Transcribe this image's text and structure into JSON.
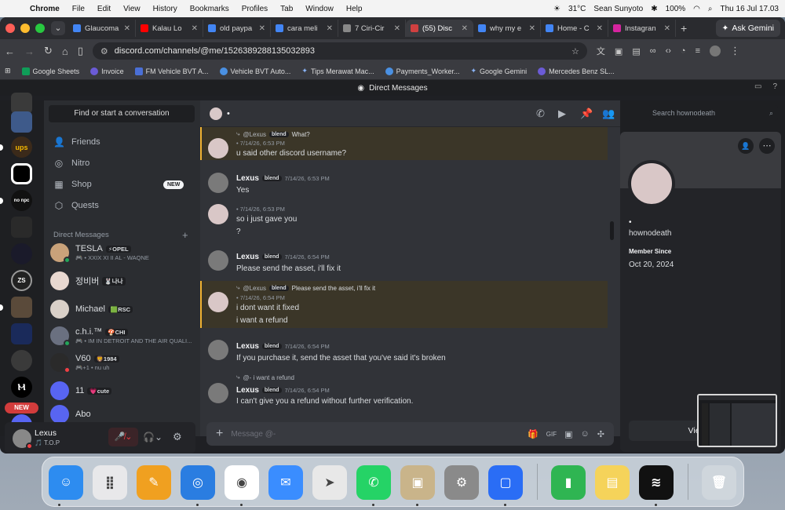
{
  "menubar": {
    "app": "Chrome",
    "items": [
      "File",
      "Edit",
      "View",
      "History",
      "Bookmarks",
      "Profiles",
      "Tab",
      "Window",
      "Help"
    ],
    "temp": "31°C",
    "user": "Sean Sunyoto",
    "battery": "100%",
    "datetime": "Thu 16 Jul  17.03"
  },
  "tabs": [
    {
      "title": "Glaucoma",
      "color": "#4285f4"
    },
    {
      "title": "Kalau Lo ",
      "color": "#ff0000"
    },
    {
      "title": "old paypa",
      "color": "#4285f4"
    },
    {
      "title": "cara meli",
      "color": "#4285f4"
    },
    {
      "title": "7 Ciri-Cir",
      "color": "#888888"
    },
    {
      "title": "(55) Disc",
      "color": "#d04040",
      "active": true
    },
    {
      "title": "why my e",
      "color": "#4285f4"
    },
    {
      "title": "Home - C",
      "color": "#4285f4"
    },
    {
      "title": "Instagran",
      "color": "#d6249f"
    }
  ],
  "gemini_label": "Ask Gemini",
  "url": "discord.com/channels/@me/1526389288135032893",
  "bookmarks": [
    "Google Sheets",
    "Invoice",
    "FM Vehicle BVT A...",
    "Vehicle BVT Auto...",
    "Tips Merawat Mac...",
    "Payments_Worker...",
    "Google Gemini",
    "Mercedes Benz SL..."
  ],
  "discord_title": "Direct Messages",
  "find": "Find or start a conversation",
  "nav": [
    "Friends",
    "Nitro",
    "Shop",
    "Quests"
  ],
  "new_tag": "NEW",
  "dm_header": "Direct Messages",
  "dms": [
    {
      "name": "TESLA",
      "tag": "⚡OPEL",
      "sub": "🎮 • XXIX XI II AL - WAQNE",
      "color": "#c9a27a"
    },
    {
      "name": "정비버",
      "tag": "🐰나나",
      "sub": "",
      "color": "#e8d8d0"
    },
    {
      "name": "Michael",
      "tag": "🟩RSC",
      "sub": "",
      "color": "#d9d0c8"
    },
    {
      "name": "c.h.i.™",
      "tag": "🍄CHI",
      "sub": "🎮 • IM IN DETROIT AND THE AIR QUALI...",
      "color": "#6a7080"
    },
    {
      "name": "V60",
      "tag": "🦁1984",
      "sub": "🎮+1 • nu uh",
      "color": "#2a2a2a"
    },
    {
      "name": "11",
      "tag": "💗cute",
      "sub": "",
      "color": "#5865f2"
    },
    {
      "name": "Abo",
      "tag": "",
      "sub": "",
      "color": "#5865f2"
    }
  ],
  "user": {
    "name": "Lexus",
    "status": "🎵 T.O.P"
  },
  "new_badge": "NEW",
  "header_name": "•",
  "search_placeholder": "Search hownodeath",
  "messages": {
    "m1_reply_name": "@Lexus",
    "m1_reply_tag": "blend",
    "m1_reply_text": "What?",
    "m1_time": "• 7/14/26, 6:53 PM",
    "m1_text": "u said other discord username?",
    "m2_name": "Lexus",
    "m2_tag": "blend",
    "m2_time": "7/14/26, 6:53 PM",
    "m2_text": "Yes",
    "m3_time": "• 7/14/26, 6:53 PM",
    "m3_text1": "so i just gave you",
    "m3_text2": "?",
    "m4_name": "Lexus",
    "m4_tag": "blend",
    "m4_time": "7/14/26, 6:54 PM",
    "m4_text": "Please send the asset, i'll fix it",
    "m5_reply_name": "@Lexus",
    "m5_reply_tag": "blend",
    "m5_reply_text": "Please send the asset, i'll fix it",
    "m5_time": "• 7/14/26, 6:54 PM",
    "m5_text1": "i dont want it fixed",
    "m5_text2": "i want a refund",
    "m6_name": "Lexus",
    "m6_tag": "blend",
    "m6_time": "7/14/26, 6:54 PM",
    "m6_text": "If you purchase it, send the asset that you've said it's broken",
    "m7_reply": "@- i want a refund",
    "m7_name": "Lexus",
    "m7_tag": "blend",
    "m7_time": "7/14/26, 6:54 PM",
    "m7_text": "I can't give you a refund without further verification."
  },
  "composer_placeholder": "Message @-",
  "profile": {
    "name": "•",
    "username": "hownodeath",
    "member_label": "Member Since",
    "member_date": "Oct 20, 2024",
    "view_btn": "View F"
  },
  "servers": [
    "ups",
    "no npc",
    "ZS",
    "NEW"
  ],
  "dock": [
    "Finder",
    "Launchpad",
    "Pages",
    "Safari",
    "Chrome",
    "Mail",
    "Maps",
    "WhatsApp",
    "Contacts",
    "System Settings",
    "Roblox",
    "Numbers",
    "Notes",
    "Spotify",
    "Trash"
  ]
}
